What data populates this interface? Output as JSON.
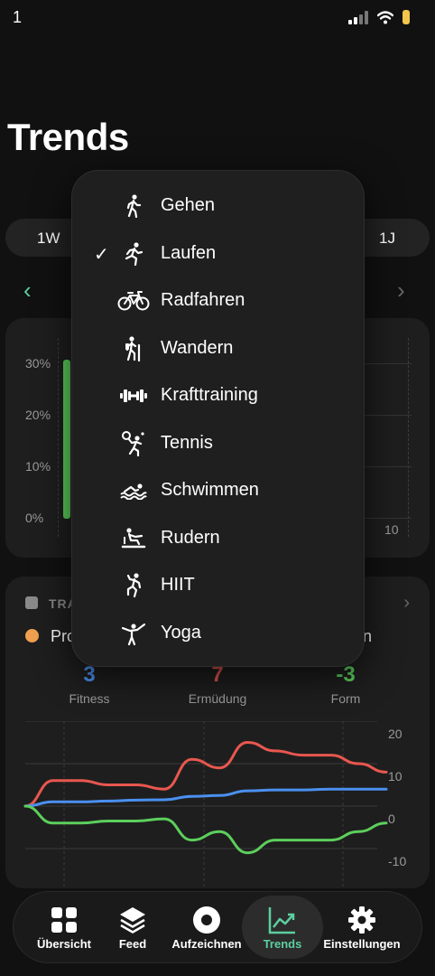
{
  "status": {
    "time": "1"
  },
  "page": {
    "title": "Trends"
  },
  "period": {
    "left": "1W",
    "right": "1J"
  },
  "card1": {
    "y_labels": [
      "30%",
      "20%",
      "10%",
      "0%"
    ],
    "x_label_right": "10"
  },
  "card2": {
    "header": "TRA",
    "legend_left": "Pro",
    "legend_right": "n",
    "metrics": [
      {
        "value": "3",
        "label": "Fitness",
        "color": "#4a90f0"
      },
      {
        "value": "7",
        "label": "Ermüdung",
        "color": "#e8574f"
      },
      {
        "value": "-3",
        "label": "Form",
        "color": "#5ccf5c"
      }
    ],
    "y_labels": [
      "20",
      "10",
      "0",
      "-10"
    ]
  },
  "chart_data": {
    "type": "line",
    "series": [
      {
        "color": "#e8574f",
        "values": [
          0,
          6,
          6,
          5,
          5,
          4,
          11,
          9,
          15,
          13,
          12,
          12,
          10,
          8
        ]
      },
      {
        "color": "#4a90f0",
        "values": [
          0,
          1,
          1,
          1.2,
          1.4,
          1.5,
          2.3,
          2.5,
          3.6,
          3.8,
          3.8,
          4,
          4,
          4
        ]
      },
      {
        "color": "#5ccf5c",
        "values": [
          0,
          -4,
          -4,
          -3.5,
          -3.5,
          -3,
          -8,
          -6,
          -11,
          -8,
          -8,
          -8,
          -6,
          -4
        ]
      }
    ],
    "ylim": [
      -12,
      22
    ]
  },
  "menu": {
    "items": [
      {
        "label": "Gehen",
        "icon": "walk-icon",
        "checked": false
      },
      {
        "label": "Laufen",
        "icon": "run-icon",
        "checked": true
      },
      {
        "label": "Radfahren",
        "icon": "bike-icon",
        "checked": false
      },
      {
        "label": "Wandern",
        "icon": "hike-icon",
        "checked": false
      },
      {
        "label": "Krafttraining",
        "icon": "dumbbell-icon",
        "checked": false
      },
      {
        "label": "Tennis",
        "icon": "tennis-icon",
        "checked": false
      },
      {
        "label": "Schwimmen",
        "icon": "swim-icon",
        "checked": false
      },
      {
        "label": "Rudern",
        "icon": "row-icon",
        "checked": false
      },
      {
        "label": "HIIT",
        "icon": "hiit-icon",
        "checked": false
      },
      {
        "label": "Yoga",
        "icon": "yoga-icon",
        "checked": false
      }
    ],
    "checkmark": "✓"
  },
  "tabs": [
    {
      "label": "Übersicht",
      "icon": "grid-icon"
    },
    {
      "label": "Feed",
      "icon": "layers-icon"
    },
    {
      "label": "Aufzeichnen",
      "icon": "record-icon"
    },
    {
      "label": "Trends",
      "icon": "trend-icon",
      "active": true,
      "color": "#5ccfa0"
    },
    {
      "label": "Einstellungen",
      "icon": "gear-icon"
    }
  ]
}
